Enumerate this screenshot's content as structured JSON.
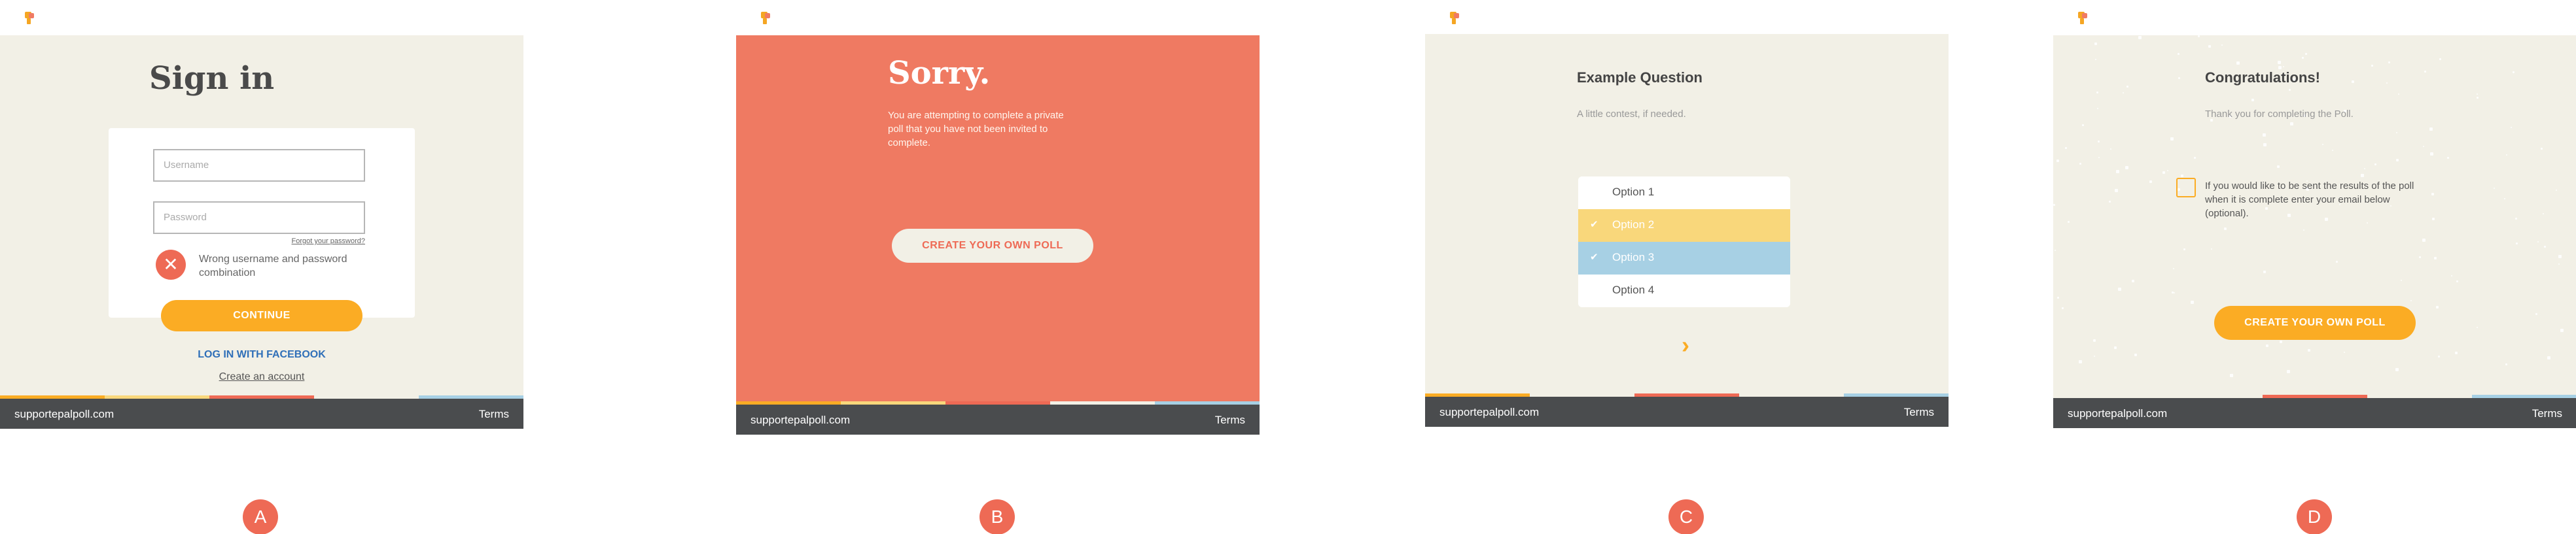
{
  "screens": {
    "a": {
      "title": "Sign in",
      "username_placeholder": "Username",
      "password_placeholder": "Password",
      "forgot_link": "Forgot your password?",
      "error_text": "Wrong username and password combination",
      "continue_label": "CONTINUE",
      "facebook_label": "LOG IN WITH FACEBOOK",
      "create_account_label": "Create an account",
      "footer_url": "supportepalpoll.com",
      "footer_terms": "Terms",
      "marker": "A"
    },
    "b": {
      "title": "Sorry.",
      "message": "You are attempting to complete a private poll that you have not been invited to complete.",
      "cta_label": "CREATE YOUR OWN POLL",
      "footer_url": "supportepalpoll.com",
      "footer_terms": "Terms",
      "marker": "B"
    },
    "c": {
      "title": "Example Question",
      "subtitle": "A little contest, if needed.",
      "options": [
        {
          "label": "Option 1",
          "selected": false,
          "color": "#ffffff"
        },
        {
          "label": "Option 2",
          "selected": true,
          "color": "#f9d77b"
        },
        {
          "label": "Option 3",
          "selected": true,
          "color": "#a7d0e4"
        },
        {
          "label": "Option 4",
          "selected": false,
          "color": "#ffffff"
        }
      ],
      "next_icon": "chevron-right-icon",
      "footer_url": "supportepalpoll.com",
      "footer_terms": "Terms",
      "marker": "C"
    },
    "d": {
      "title": "Congratulations!",
      "subtitle": "Thank you for completing the Poll.",
      "checkbox_text": "If you would like to be sent the results of the poll when it is complete enter your email below (optional).",
      "cta_label": "CREATE YOUR OWN POLL",
      "footer_url": "supportepalpoll.com",
      "footer_terms": "Terms",
      "marker": "D"
    }
  },
  "colors": {
    "cream": "#f2f0e6",
    "coral": "#ef7a62",
    "orange": "#fbac24",
    "yellow": "#f9d77b",
    "blue": "#a7d0e4",
    "red": "#ee6a55",
    "dark": "#4a4c4e",
    "facebook": "#2f6fb8"
  }
}
